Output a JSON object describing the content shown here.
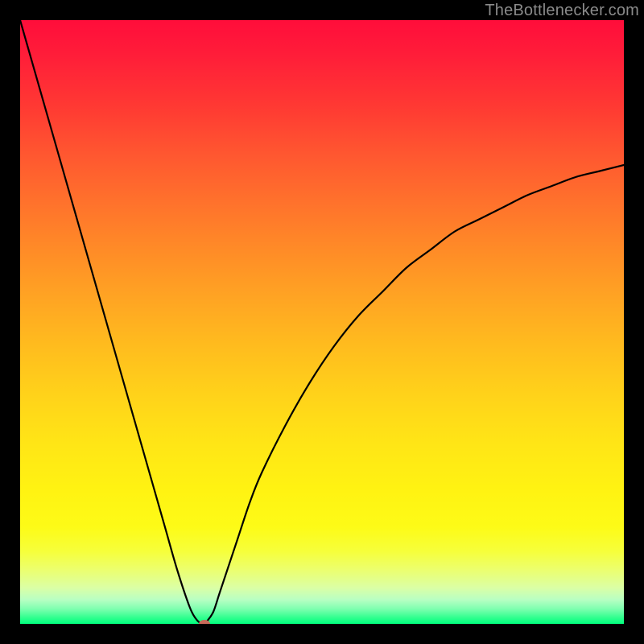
{
  "watermark": "TheBottlenecker.com",
  "chart_data": {
    "type": "line",
    "title": "",
    "xlabel": "",
    "ylabel": "",
    "xlim": [
      0,
      100
    ],
    "ylim": [
      0,
      100
    ],
    "grid": false,
    "legend": false,
    "background_gradient": {
      "direction": "vertical",
      "stops": [
        {
          "pos": 0.0,
          "color": "#ff0d3a"
        },
        {
          "pos": 0.5,
          "color": "#ffb820"
        },
        {
          "pos": 0.85,
          "color": "#fdfb17"
        },
        {
          "pos": 1.0,
          "color": "#00ff7d"
        }
      ]
    },
    "series": [
      {
        "name": "bottleneck-curve",
        "color": "#000000",
        "x": [
          0,
          2,
          4,
          6,
          8,
          10,
          12,
          14,
          16,
          18,
          20,
          22,
          24,
          26,
          28,
          29,
          30,
          30.5,
          31,
          32,
          33,
          34,
          36,
          38,
          40,
          44,
          48,
          52,
          56,
          60,
          64,
          68,
          72,
          76,
          80,
          84,
          88,
          92,
          96,
          100
        ],
        "y": [
          100,
          93,
          86,
          79,
          72,
          65,
          58,
          51,
          44,
          37,
          30,
          23,
          16,
          9,
          3,
          1,
          0,
          0,
          0.5,
          2,
          5,
          8,
          14,
          20,
          25,
          33,
          40,
          46,
          51,
          55,
          59,
          62,
          65,
          67,
          69,
          71,
          72.5,
          74,
          75,
          76
        ]
      }
    ],
    "optimum_marker": {
      "x": 30.5,
      "y": 0,
      "color": "#c96a5a"
    }
  }
}
